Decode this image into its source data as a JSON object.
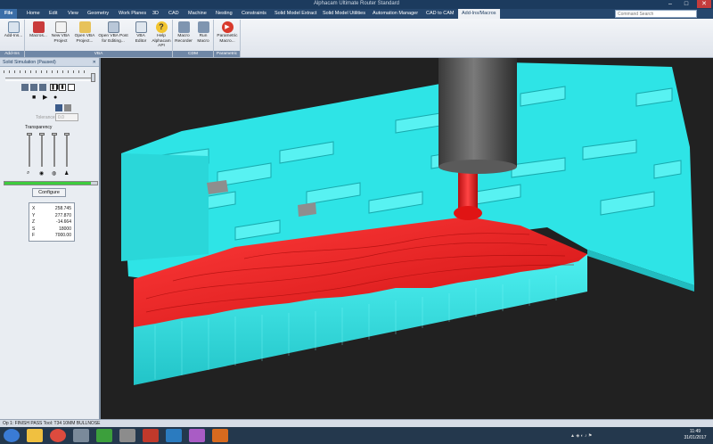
{
  "window": {
    "title": "Alphacam Ultimate Router Standard",
    "min": "–",
    "max": "□",
    "close": "✕"
  },
  "menu": {
    "tabs": [
      "File",
      "Home",
      "Edit",
      "View",
      "Geometry",
      "Work Planes",
      "3D",
      "CAD",
      "Machine",
      "Nesting",
      "Constraints",
      "Solid Model Extract",
      "Solid Model Utilities",
      "Automation Manager",
      "CAD to CAM",
      "Add-Ins/Macros"
    ],
    "active_index": 15
  },
  "command": {
    "placeholder": "Command Search"
  },
  "ribbon": {
    "groups": [
      {
        "label": "Add-Ins",
        "buttons": [
          {
            "label": "Add-Ins...",
            "icon": "add-ins-icon"
          }
        ]
      },
      {
        "label": "VBA",
        "buttons": [
          {
            "label": "Macros...",
            "icon": "macros-icon"
          },
          {
            "label": "New VBA\nProject",
            "icon": "new-vba-icon"
          },
          {
            "label": "Open VBA\nProject...",
            "icon": "open-vba-icon"
          },
          {
            "label": "Open VBA Post\nfor Editing...",
            "icon": "open-post-icon"
          },
          {
            "label": "VBA\nEditor",
            "icon": "vba-editor-icon"
          },
          {
            "label": "Help Alphacam\nAPI",
            "icon": "help-icon"
          }
        ]
      },
      {
        "label": "CDM",
        "buttons": [
          {
            "label": "Macro\nRecorder",
            "icon": "recorder-icon"
          },
          {
            "label": "Run\nMacro",
            "icon": "run-macro-icon"
          }
        ]
      },
      {
        "label": "Parametric",
        "buttons": [
          {
            "label": "Parametric\nMacro...",
            "icon": "play-icon"
          }
        ]
      }
    ]
  },
  "panel": {
    "title": "Solid Simulation (Paused)",
    "tolerance_label": "Tolerance",
    "tolerance_value": "0.0",
    "transparency_label": "Transparency",
    "progress": 0.93,
    "configure_label": "Configure",
    "readout": [
      {
        "k": "X",
        "v": "258.745"
      },
      {
        "k": "Y",
        "v": "277.870"
      },
      {
        "k": "Z",
        "v": "-14.664"
      },
      {
        "k": "S",
        "v": "18000"
      },
      {
        "k": "F",
        "v": "7000.00"
      }
    ]
  },
  "status": {
    "text": "Op 1: FINISH PASS  Tool: T34 10MM BULLNOSE"
  },
  "taskbar": {
    "time": "11:49",
    "date": "31/01/2017"
  },
  "colors": {
    "stock": "#28e0e0",
    "cut": "#e8181a",
    "tool": "#4a4a4a",
    "bg": "#212121"
  }
}
